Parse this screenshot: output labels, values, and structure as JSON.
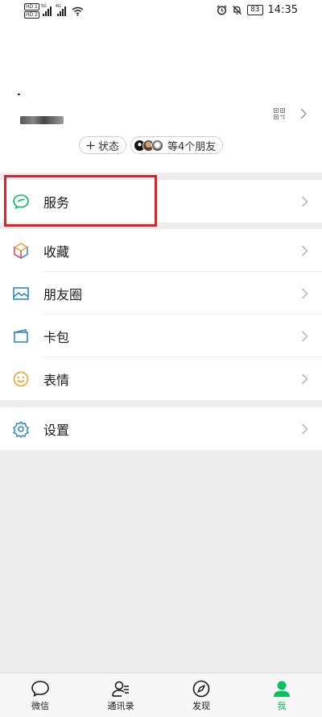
{
  "status_bar": {
    "sim1": "HD 1",
    "sim2": "HD 2",
    "net1": "5G",
    "net2": "4G",
    "battery": "83",
    "time": "14:35"
  },
  "profile": {
    "status_button": "状态",
    "friends_text": "等4个朋友"
  },
  "menu": {
    "services": "服务",
    "favorites": "收藏",
    "moments": "朋友圈",
    "cards": "卡包",
    "stickers": "表情",
    "settings": "设置"
  },
  "tabs": [
    {
      "label": "微信",
      "icon": "chat-bubble-icon"
    },
    {
      "label": "通讯录",
      "icon": "contacts-icon"
    },
    {
      "label": "发现",
      "icon": "compass-icon"
    },
    {
      "label": "我",
      "icon": "person-icon"
    }
  ],
  "colors": {
    "accent": "#07c160",
    "highlight": "#e0202a",
    "background": "#ededed"
  }
}
